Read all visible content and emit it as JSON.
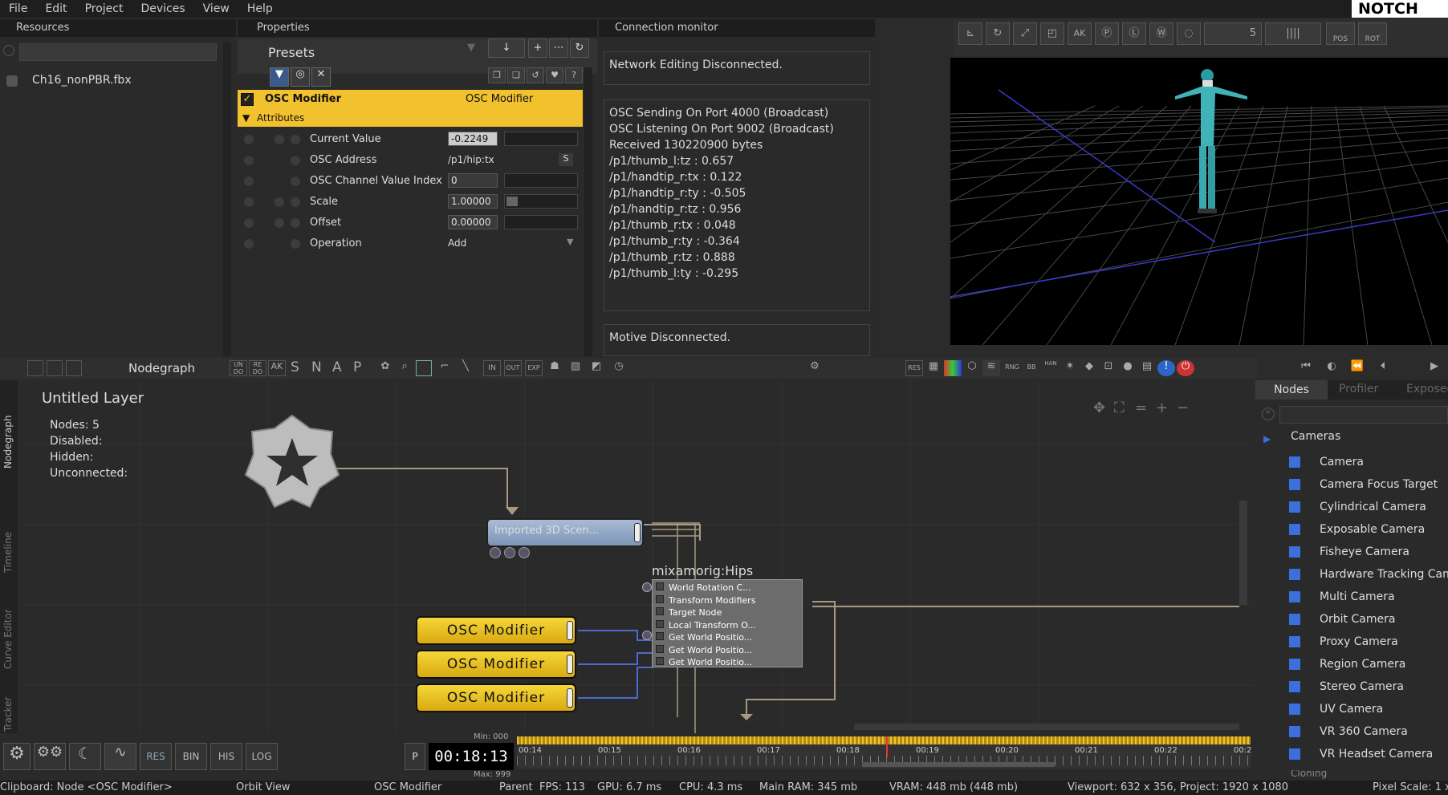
{
  "menu": [
    "File",
    "Edit",
    "Project",
    "Devices",
    "View",
    "Help"
  ],
  "logo": "NOTCH",
  "resources": {
    "title": "Resources",
    "file": "Ch16_nonPBR.fbx"
  },
  "properties": {
    "title": "Properties",
    "presets": "Presets",
    "node_name": "OSC Modifier",
    "node_type": "OSC Modifier",
    "section": "Attributes",
    "attributes": [
      {
        "label": "Current Value",
        "value": "-0.2249"
      },
      {
        "label": "OSC Address",
        "value": "/p1/hip:tx",
        "extra": "S"
      },
      {
        "label": "OSC Channel Value Index",
        "value": "0"
      },
      {
        "label": "Scale",
        "value": "1.00000"
      },
      {
        "label": "Offset",
        "value": "0.00000"
      },
      {
        "label": "Operation",
        "value": "Add"
      }
    ]
  },
  "monitor": {
    "title": "Connection monitor",
    "network": "Network Editing Disconnected.",
    "lines": [
      "OSC Sending On Port 4000 (Broadcast)",
      "OSC Listening On Port 9002 (Broadcast)",
      "Received 130220900 bytes",
      "/p1/thumb_l:tz : 0.657",
      "/p1/handtip_r:tx : 0.122",
      "/p1/handtip_r:ty : -0.505",
      "/p1/handtip_r:tz : 0.956",
      "/p1/thumb_r:tx : 0.048",
      "/p1/thumb_r:ty : -0.364",
      "/p1/thumb_r:tz : 0.888",
      "/p1/thumb_l:ty : -0.295"
    ],
    "motive": "Motive Disconnected."
  },
  "viewport_toolbar_number": "5",
  "viewport_labels": {
    "pos": "POS",
    "rot": "ROT"
  },
  "nodegraph": {
    "title": "Nodegraph",
    "toolbar_letters": [
      "S",
      "N",
      "A",
      "P"
    ],
    "layer": "Untitled  Layer",
    "stats": [
      {
        "k": "Nodes:",
        "v": "5"
      },
      {
        "k": "Disabled:",
        "v": ""
      },
      {
        "k": "Hidden:",
        "v": ""
      },
      {
        "k": "Unconnected:",
        "v": ""
      }
    ],
    "imported": "Imported  3D  Scen...",
    "hips_title": "mixamorig:Hips",
    "hips_rows": [
      "World  Rotation  C...",
      "Transform  Modifiers",
      "Target  Node",
      "Local  Transform  O...",
      "Get  World  Positio...",
      "Get  World  Positio...",
      "Get  World  Positio..."
    ],
    "osc_nodes": [
      "OSC  Modifier",
      "OSC  Modifier",
      "OSC  Modifier"
    ]
  },
  "side_tabs": [
    "Nodegraph",
    "Timeline",
    "Curve Editor",
    "Tracker"
  ],
  "nodes_panel": {
    "tabs": [
      "Nodes",
      "Profiler",
      "Exposed"
    ],
    "category": "Cameras",
    "items": [
      "Camera",
      "Camera Focus Target",
      "Cylindrical Camera",
      "Exposable Camera",
      "Fisheye Camera",
      "Hardware Tracking Cam",
      "Multi Camera",
      "Orbit Camera",
      "Proxy Camera",
      "Region Camera",
      "Stereo Camera",
      "UV Camera",
      "VR 360 Camera",
      "VR Headset Camera"
    ],
    "next_category": "Cloning"
  },
  "timeline": {
    "min": "Min: 000",
    "max": "Max: 999",
    "time": "00:18:13",
    "p": "P",
    "ticks": [
      "00:14",
      "00:15",
      "00:16",
      "00:17",
      "00:18",
      "00:19",
      "00:20",
      "00:21",
      "00:22",
      "00:2"
    ],
    "buttons": [
      "RES",
      "BIN",
      "HIS",
      "LOG"
    ]
  },
  "status": {
    "clipboard": "Clipboard: Node <OSC Modifier>",
    "view": "Orbit View",
    "selected": "OSC Modifier",
    "parent": "Parent",
    "fps": "FPS: 113",
    "gpu": "GPU: 6.7 ms",
    "cpu": "CPU: 4.3 ms",
    "ram": "Main RAM: 345 mb",
    "vram": "VRAM: 448 mb (448 mb)",
    "viewport": "Viewport: 632 x 356, Project: 1920 x 1080",
    "pixel": "Pixel Scale: 1 x"
  },
  "colors": {
    "accent": "#f2c12e",
    "node_blue": "#8fa6c4",
    "viewport_bg": "#000000",
    "link_blue": "#3a6fdc"
  }
}
